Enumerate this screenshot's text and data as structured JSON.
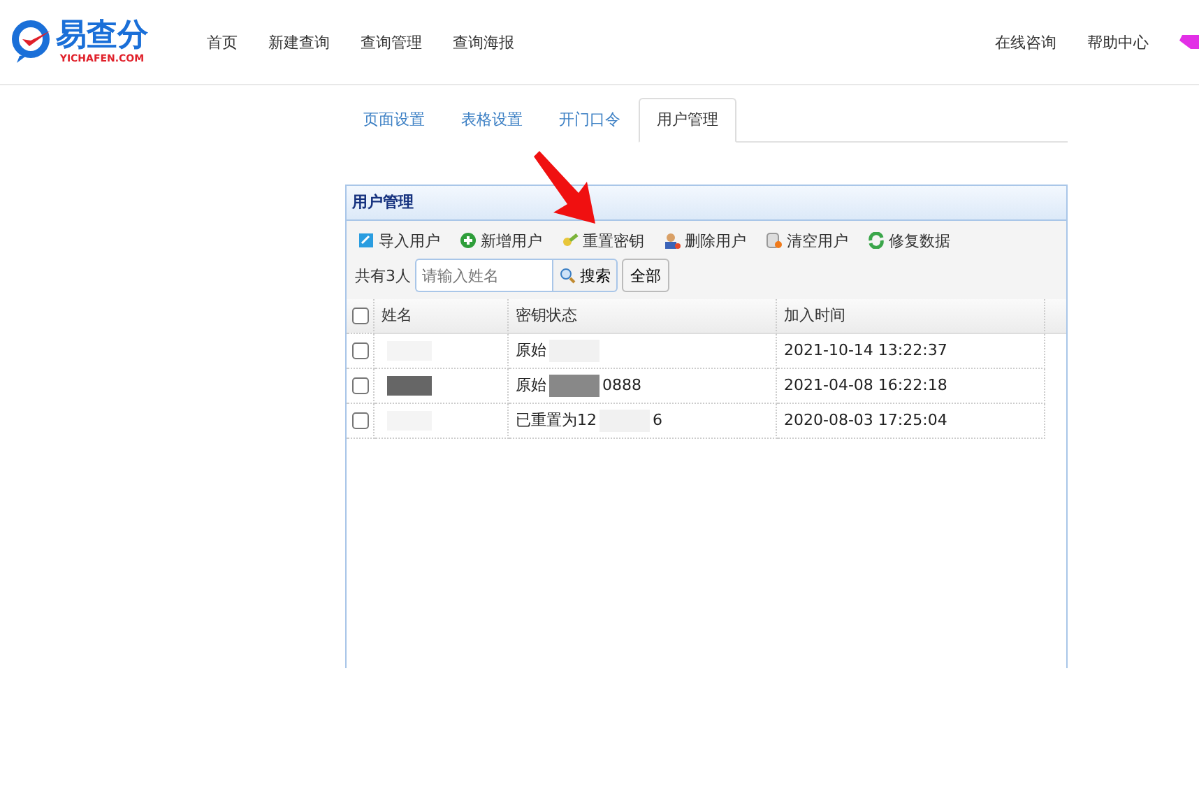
{
  "header": {
    "logo_text": "易查分",
    "logo_sub": "YICHAFEN.COM",
    "nav": [
      "首页",
      "新建查询",
      "查询管理",
      "查询海报"
    ],
    "right_links": [
      "在线咨询",
      "帮助中心"
    ]
  },
  "tabs": [
    {
      "label": "页面设置",
      "selected": false
    },
    {
      "label": "表格设置",
      "selected": false
    },
    {
      "label": "开门口令",
      "selected": false
    },
    {
      "label": "用户管理",
      "selected": true
    }
  ],
  "panel": {
    "title": "用户管理",
    "toolbar": [
      {
        "label": "导入用户",
        "kind": "import"
      },
      {
        "label": "新增用户",
        "kind": "add"
      },
      {
        "label": "重置密钥",
        "kind": "key"
      },
      {
        "label": "删除用户",
        "kind": "delete"
      },
      {
        "label": "清空用户",
        "kind": "clear"
      },
      {
        "label": "修复数据",
        "kind": "repair"
      }
    ],
    "count": "共有3人",
    "search": {
      "placeholder": "请输入姓名",
      "button": "搜索"
    },
    "all_button": "全部",
    "table": {
      "select_all_checked": false,
      "columns": [
        "姓名",
        "密钥状态",
        "加入时间"
      ],
      "rows": [
        {
          "checked": false,
          "status": "原始",
          "status_tail": "",
          "time": "2021-10-14 13:22:37"
        },
        {
          "checked": false,
          "status": "原始",
          "status_tail": "0888",
          "time": "2021-04-08 16:22:18"
        },
        {
          "checked": false,
          "status": "已重置为12",
          "status_tail": "6",
          "time": "2020-08-03 17:25:04"
        }
      ]
    }
  }
}
